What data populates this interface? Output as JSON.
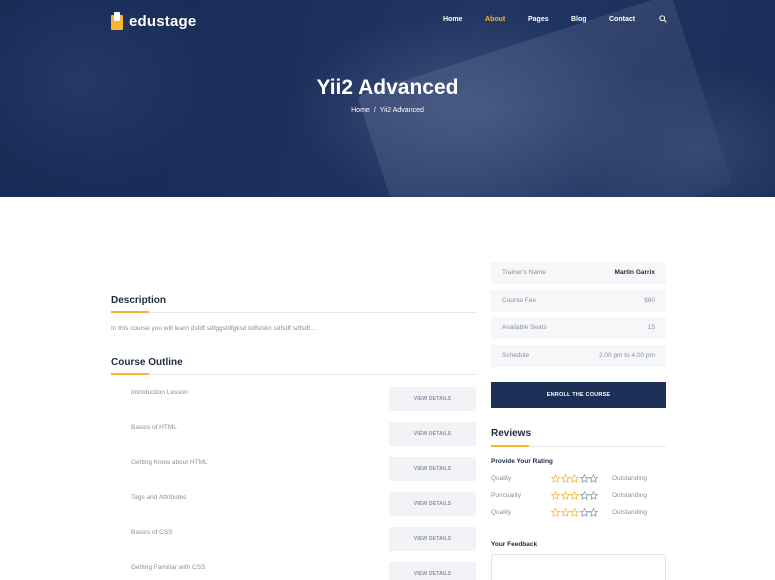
{
  "brand": {
    "name": "edustage"
  },
  "nav": {
    "items": [
      {
        "label": "Home",
        "active": false
      },
      {
        "label": "About",
        "active": true
      },
      {
        "label": "Pages",
        "active": false
      },
      {
        "label": "Blog",
        "active": false
      },
      {
        "label": "Contact",
        "active": false
      }
    ],
    "search_icon": "search-icon"
  },
  "hero": {
    "title": "Yii2 Advanced",
    "breadcrumb": [
      "Home",
      "/",
      "Yii2 Advanced"
    ]
  },
  "description": {
    "title": "Description",
    "text": "In this course you will learn dsfdf sdfggsldfgksd kdfslskn sdfsdf sdfsdf..."
  },
  "outline": {
    "title": "Course Outline",
    "button_label": "VIEW DETAILS",
    "lessons": [
      "Introduction Lesson",
      "Basics of HTML",
      "Getting Know about HTML",
      "Tags and Attributes",
      "Basics of CSS",
      "Getting Familiar with CSS"
    ]
  },
  "course_info": [
    {
      "label": "Trainer's Name",
      "value": "Martin Garrix",
      "strong": true
    },
    {
      "label": "Course Fee",
      "value": "$60",
      "strong": false
    },
    {
      "label": "Available Seats",
      "value": "15",
      "strong": false
    },
    {
      "label": "Schedule",
      "value": "2.00 pm to 4.00 pm",
      "strong": false
    }
  ],
  "enroll": {
    "label": "ENROLL THE COURSE"
  },
  "reviews": {
    "title": "Reviews",
    "provide_label": "Provide Your Rating",
    "max_stars": 5,
    "ratings": [
      {
        "label": "Quality",
        "stars": 3,
        "value": "Outstanding"
      },
      {
        "label": "Puncuality",
        "stars": 3,
        "value": "Outstanding"
      },
      {
        "label": "Quality",
        "stars": 3,
        "value": "Outstanding"
      }
    ],
    "feedback_label": "Your Feedback"
  },
  "colors": {
    "accent": "#f5b731",
    "navy": "#1c2f56",
    "muted": "#8a90a0"
  }
}
